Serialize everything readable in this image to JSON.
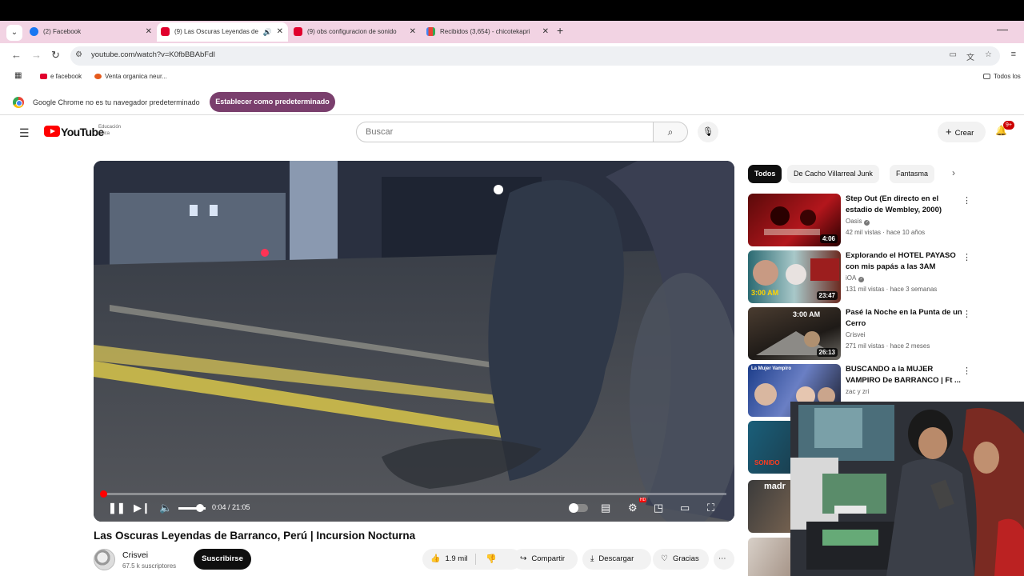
{
  "browser": {
    "tabs": [
      {
        "title": "(2) Facebook",
        "favicon": "facebook-icon"
      },
      {
        "title": "(9) Las Oscuras Leyendas de",
        "favicon": "youtube-icon",
        "active": true
      },
      {
        "title": "(9) obs configuracion de sonido",
        "favicon": "youtube-icon"
      },
      {
        "title": "Recibidos (3,654) - chicotekapri",
        "favicon": "gmail-icon"
      }
    ],
    "url": "youtube.com/watch?v=K0fbBBAbFdI",
    "bookmarks": [
      "e facebook",
      "Venta organica neur...",
      "Todos los"
    ],
    "default_message": "Google Chrome no es tu navegador predeterminado",
    "default_button": "Establecer como predeterminado"
  },
  "youtube": {
    "logo_text": "YouTube",
    "logo_sub": "Educación física",
    "search_placeholder": "Buscar",
    "create_label": "Crear",
    "notif_badge": "9+"
  },
  "video": {
    "title": "Las Oscuras Leyendas de Barranco, Perú | Incursion Nocturna",
    "time": "0:04 / 21:05",
    "progress": 0.003,
    "volume": 0.8,
    "channel": "Crisvei",
    "subscribers": "67.5 k suscriptores",
    "subscribe_label": "Suscribirse",
    "likes": "1.9 mil",
    "share_label": "Compartir",
    "download_label": "Descargar",
    "thanks_label": "Gracias"
  },
  "sidebar": {
    "chips": [
      "Todos",
      "De Cacho Villarreal Junk",
      "Fantasma"
    ],
    "recommendations": [
      {
        "title": "Step Out (En directo en el estadio de Wembley, 2000)",
        "channel": "Oasis",
        "meta": "42 mil vistas · hace 10 años",
        "duration": "4:06",
        "thumb_text": ""
      },
      {
        "title": "Explorando el HOTEL PAYASO con mis papás a las 3AM",
        "channel": "iOA",
        "meta": "131 mil vistas · hace 3 semanas",
        "duration": "23:47",
        "thumb_text": "3:00 AM"
      },
      {
        "title": "Pasé la Noche en la Punta de un Cerro",
        "channel": "Crisvei",
        "meta": "271 mil vistas · hace 2 meses",
        "duration": "26:13",
        "thumb_text": "3:00 AM"
      },
      {
        "title": "BUSCANDO a la MUJER VAMPIRO De BARRANCO | Ft ...",
        "channel": "zac y zri",
        "meta": "",
        "duration": "",
        "thumb_text": "La Mujer Vampiro"
      }
    ],
    "partial_thumbs": [
      "SONIDO",
      "madr"
    ]
  },
  "colors": {
    "tab_strip": "#f2d3e3",
    "default_button": "#7a3f6d",
    "youtube_red": "#ff0000",
    "progress": "#ff0000"
  }
}
